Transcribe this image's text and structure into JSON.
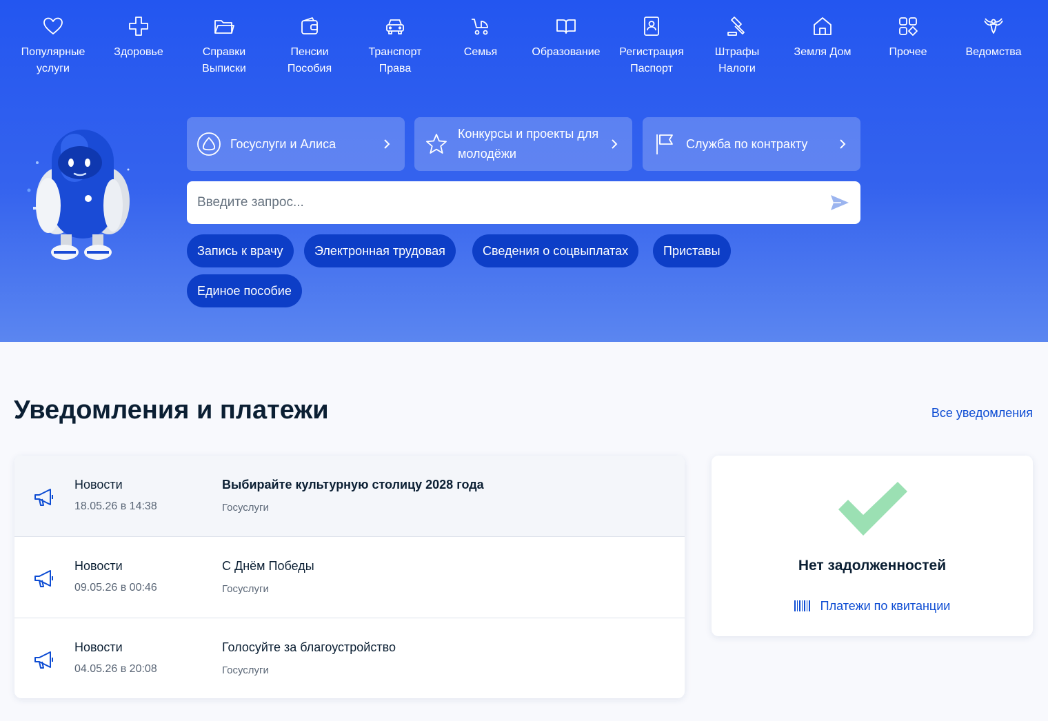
{
  "categories": [
    {
      "icon": "heart-icon",
      "lines": [
        "Популярные",
        "услуги"
      ]
    },
    {
      "icon": "cross-icon",
      "lines": [
        "Здоровье"
      ]
    },
    {
      "icon": "folder-icon",
      "lines": [
        "Справки",
        "Выписки"
      ]
    },
    {
      "icon": "wallet-icon",
      "lines": [
        "Пенсии",
        "Пособия"
      ]
    },
    {
      "icon": "car-icon",
      "lines": [
        "Транспорт",
        "Права"
      ]
    },
    {
      "icon": "stroller-icon",
      "lines": [
        "Семья"
      ]
    },
    {
      "icon": "book-icon",
      "lines": [
        "Образование"
      ]
    },
    {
      "icon": "passport-icon",
      "lines": [
        "Регистрация",
        "Паспорт"
      ]
    },
    {
      "icon": "gavel-icon",
      "lines": [
        "Штрафы",
        "Налоги"
      ]
    },
    {
      "icon": "house-icon",
      "lines": [
        "Земля Дом"
      ]
    },
    {
      "icon": "grid-icon",
      "lines": [
        "Прочее"
      ]
    },
    {
      "icon": "eagle-icon",
      "lines": [
        "Ведомства"
      ]
    }
  ],
  "quick_links": [
    {
      "icon": "alice-icon",
      "label": "Госуслуги и Алиса"
    },
    {
      "icon": "star-icon",
      "label": "Конкурсы и проекты для молодёжи"
    },
    {
      "icon": "flag-icon",
      "label": "Служба по контракту"
    }
  ],
  "search": {
    "placeholder": "Введите запрос..."
  },
  "chips": [
    "Запись к врачу",
    "Электронная трудовая",
    "Сведения о соцвыплатах",
    "Приставы",
    "Единое пособие"
  ],
  "notifications_section": {
    "title": "Уведомления и платежи",
    "all_link": "Все уведомления",
    "items": [
      {
        "category": "Новости",
        "date": "18.05.26 в 14:38",
        "title": "Выбирайте культурную столицу 2028 года",
        "source": "Госуслуги",
        "unread": true
      },
      {
        "category": "Новости",
        "date": "09.05.26 в 00:46",
        "title": "С Днём Победы",
        "source": "Госуслуги",
        "unread": false
      },
      {
        "category": "Новости",
        "date": "04.05.26 в 20:08",
        "title": "Голосуйте за благоустройство",
        "source": "Госуслуги",
        "unread": false
      }
    ]
  },
  "payments": {
    "status": "Нет задолженностей",
    "link": "Платежи по квитанции"
  },
  "colors": {
    "hero_top": "#2356f0",
    "chip": "#0d3ec7",
    "link": "#0d4cd3",
    "check": "#9be0b3"
  }
}
